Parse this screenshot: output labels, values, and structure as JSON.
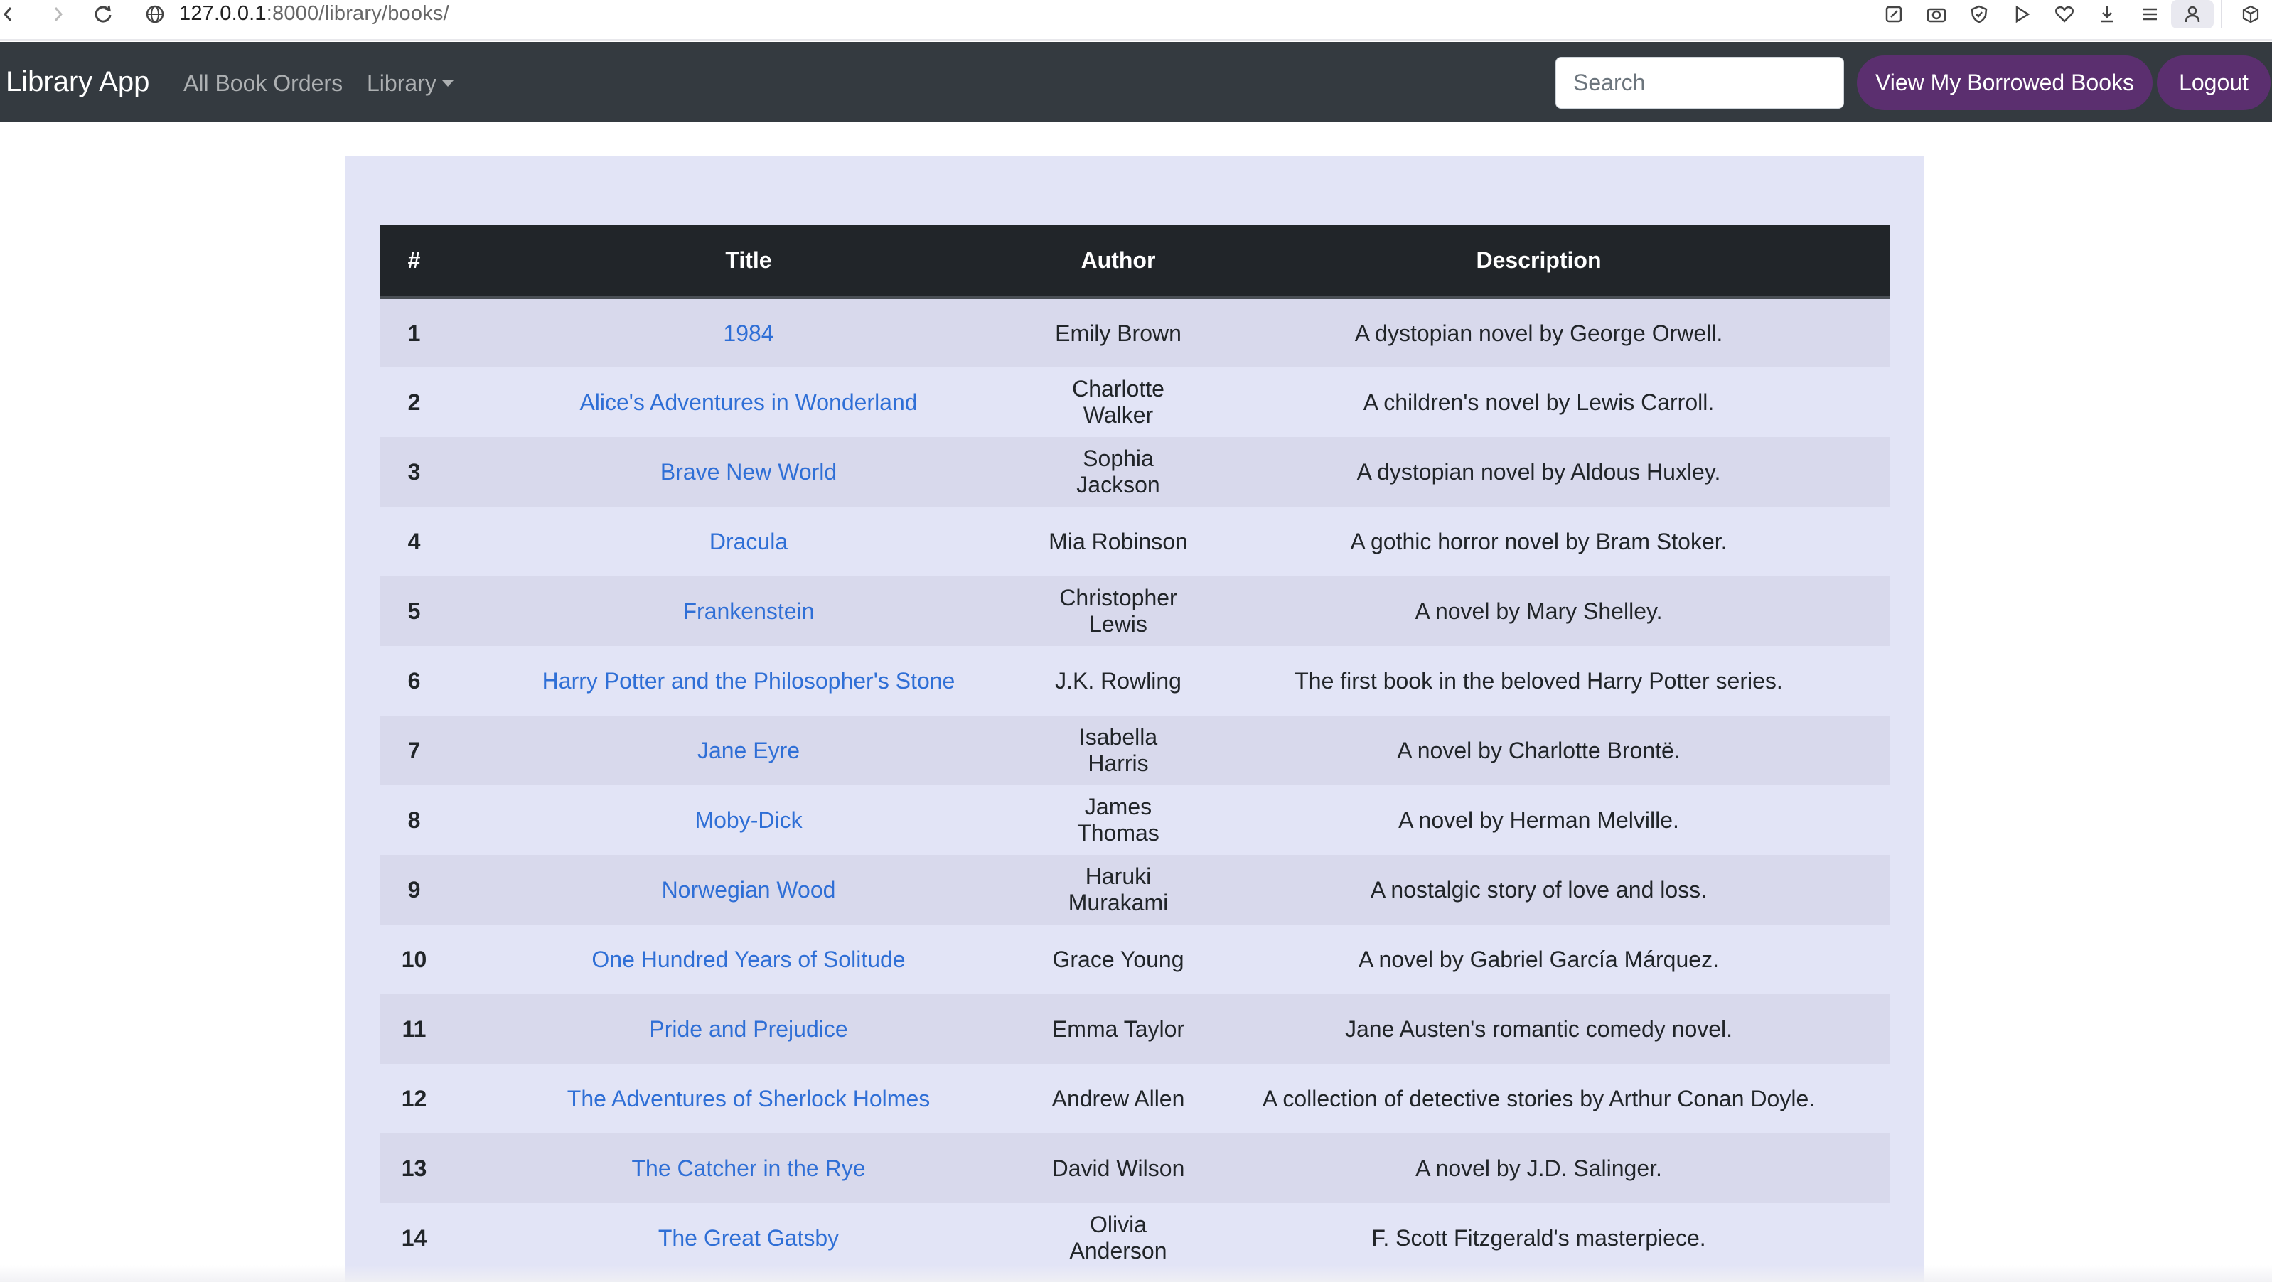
{
  "browser": {
    "url_host": "127.0.0.1",
    "url_path": ":8000/library/books/"
  },
  "navbar": {
    "brand": "Library App",
    "links": [
      "All Book Orders",
      "Library"
    ],
    "search_placeholder": "Search",
    "borrowed_button": "View My Borrowed Books",
    "logout_button": "Logout"
  },
  "table": {
    "headers": [
      "#",
      "Title",
      "Author",
      "Description"
    ],
    "rows": [
      {
        "num": "1",
        "title": "1984",
        "author": "Emily Brown",
        "description": "A dystopian novel by George Orwell."
      },
      {
        "num": "2",
        "title": "Alice's Adventures in Wonderland",
        "author": "Charlotte Walker",
        "description": "A children's novel by Lewis Carroll."
      },
      {
        "num": "3",
        "title": "Brave New World",
        "author": "Sophia Jackson",
        "description": "A dystopian novel by Aldous Huxley."
      },
      {
        "num": "4",
        "title": "Dracula",
        "author": "Mia Robinson",
        "description": "A gothic horror novel by Bram Stoker."
      },
      {
        "num": "5",
        "title": "Frankenstein",
        "author": "Christopher Lewis",
        "description": "A novel by Mary Shelley."
      },
      {
        "num": "6",
        "title": "Harry Potter and the Philosopher's Stone",
        "author": "J.K. Rowling",
        "description": "The first book in the beloved Harry Potter series."
      },
      {
        "num": "7",
        "title": "Jane Eyre",
        "author": "Isabella Harris",
        "description": "A novel by Charlotte Brontë."
      },
      {
        "num": "8",
        "title": "Moby-Dick",
        "author": "James Thomas",
        "description": "A novel by Herman Melville."
      },
      {
        "num": "9",
        "title": "Norwegian Wood",
        "author": "Haruki Murakami",
        "description": "A nostalgic story of love and loss."
      },
      {
        "num": "10",
        "title": "One Hundred Years of Solitude",
        "author": "Grace Young",
        "description": "A novel by Gabriel García Márquez."
      },
      {
        "num": "11",
        "title": "Pride and Prejudice",
        "author": "Emma Taylor",
        "description": "Jane Austen's romantic comedy novel."
      },
      {
        "num": "12",
        "title": "The Adventures of Sherlock Holmes",
        "author": "Andrew Allen",
        "description": "A collection of detective stories by Arthur Conan Doyle."
      },
      {
        "num": "13",
        "title": "The Catcher in the Rye",
        "author": "David Wilson",
        "description": "A novel by J.D. Salinger."
      },
      {
        "num": "14",
        "title": "The Great Gatsby",
        "author": "Olivia Anderson",
        "description": "F. Scott Fitzgerald's masterpiece."
      }
    ]
  },
  "colors": {
    "navbar_bg": "#343a40",
    "accent_purple": "#5b2f6f",
    "panel_bg": "#e2e4f6",
    "link_blue": "#2f6fd6"
  }
}
